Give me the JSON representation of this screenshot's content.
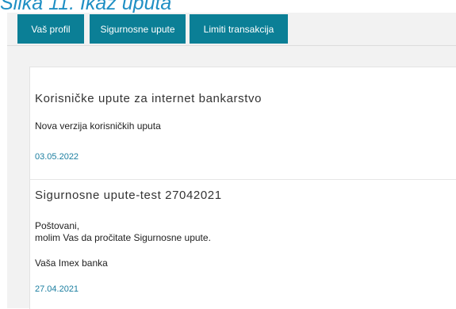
{
  "caption": "Slika 11. Ikaz uputa",
  "tabs": [
    {
      "label": "Vaš profil"
    },
    {
      "label": "Sigurnosne upute"
    },
    {
      "label": "Limiti transakcija"
    }
  ],
  "items": [
    {
      "title": "Korisničke upute za internet bankarstvo",
      "lines": [
        "Nova verzija korisničkih uputa"
      ],
      "date": "03.05.2022"
    },
    {
      "title": "Sigurnosne upute-test 27042021",
      "lines": [
        "Poštovani,",
        "molim Vas da pročitate Sigurnosne upute.",
        "Vaša Imex banka"
      ],
      "date": "27.04.2021"
    }
  ],
  "colors": {
    "tab_bg": "#0b7f96",
    "date": "#1b7ea0",
    "caption": "#1f8fc4"
  }
}
